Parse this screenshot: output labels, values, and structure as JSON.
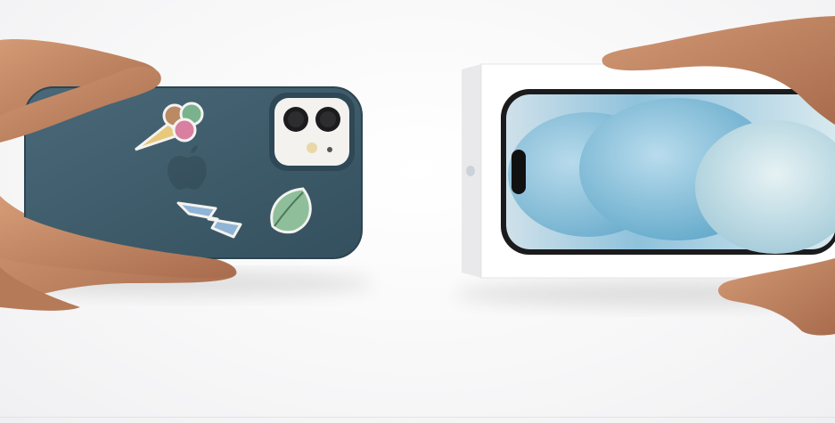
{
  "scene": {
    "description_colors": {
      "background": "#f5f5f7",
      "case_color": "#3e5a69",
      "camera_bump": "#f4f2ee",
      "box_white": "#ffffff",
      "screen_blue": "#8fc2dc",
      "skin": "#c88a66"
    },
    "stickers": [
      "ice-cream-sticker",
      "lightning-sticker",
      "leaf-sticker"
    ],
    "icons": [
      "apple-logo-icon"
    ]
  }
}
